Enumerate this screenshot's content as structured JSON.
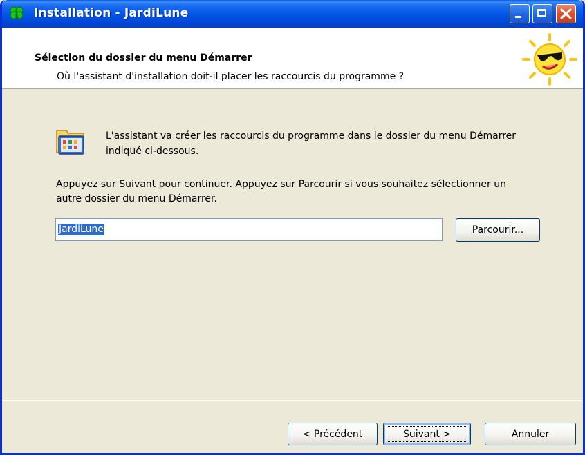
{
  "window": {
    "title": "Installation - JardiLune"
  },
  "header": {
    "title": "Sélection du dossier du menu Démarrer",
    "subtitle": "Où l'assistant d'installation doit-il placer les raccourcis du programme ?"
  },
  "main": {
    "info_text": "L'assistant va créer les raccourcis du programme dans le dossier du menu Démarrer indiqué ci-dessous.",
    "instruction_text": "Appuyez sur Suivant pour continuer. Appuyez sur Parcourir si vous souhaitez sélectionner un autre dossier du menu Démarrer.",
    "folder_value": "JardiLune",
    "browse_label": "Parcourir..."
  },
  "footer": {
    "prev_label": "< Précédent",
    "next_label": "Suivant >",
    "cancel_label": "Annuler"
  },
  "icons": {
    "app": "clover-icon",
    "header_logo": "sun-with-sunglasses-icon",
    "main": "program-group-folder-icon"
  },
  "colors": {
    "titlebar": "#0054e3",
    "background": "#ece9d8",
    "selection": "#316ac5"
  }
}
